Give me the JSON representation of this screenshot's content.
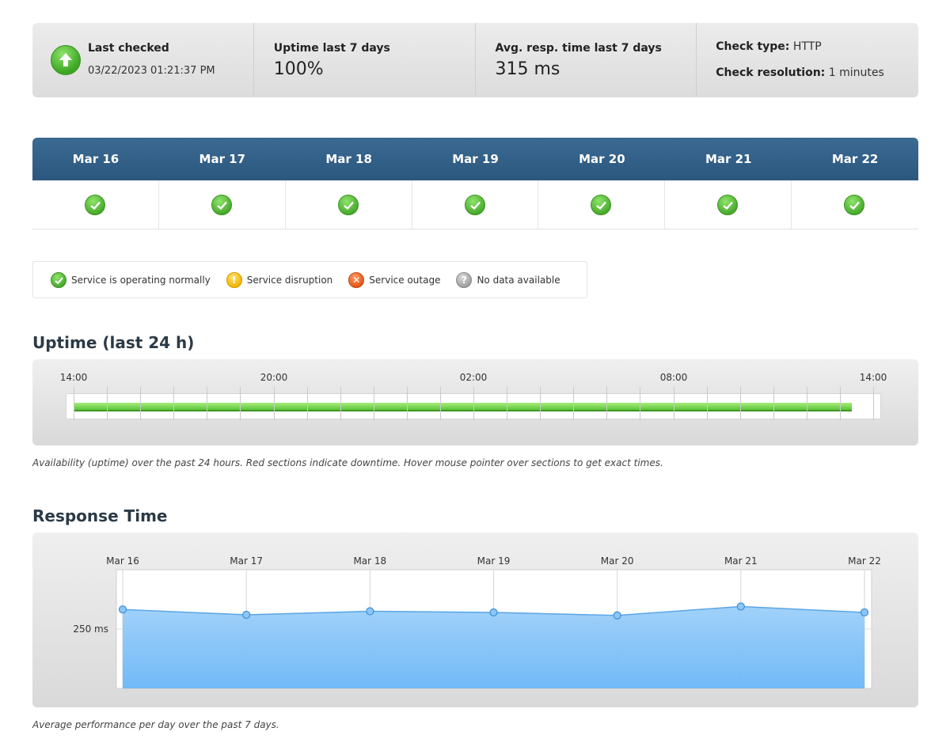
{
  "summary": {
    "last_checked_label": "Last checked",
    "last_checked_value": "03/22/2023 01:21:37 PM",
    "uptime_label": "Uptime last 7 days",
    "uptime_value": "100%",
    "resp_label": "Avg. resp. time last 7 days",
    "resp_value": "315 ms",
    "check_type_label": "Check type:",
    "check_type_value": "HTTP",
    "check_resolution_label": "Check resolution:",
    "check_resolution_value": "1 minutes",
    "status_icon": "up-arrow-icon"
  },
  "week": {
    "days": [
      "Mar 16",
      "Mar 17",
      "Mar 18",
      "Mar 19",
      "Mar 20",
      "Mar 21",
      "Mar 22"
    ],
    "status": [
      "ok",
      "ok",
      "ok",
      "ok",
      "ok",
      "ok",
      "ok"
    ]
  },
  "legend": [
    {
      "icon": "ok",
      "label": "Service is operating normally"
    },
    {
      "icon": "warn",
      "label": "Service disruption"
    },
    {
      "icon": "bad",
      "label": "Service outage"
    },
    {
      "icon": "nodata",
      "label": "No data available"
    }
  ],
  "uptime": {
    "title": "Uptime (last 24 h)",
    "tick_labels": [
      "14:00",
      "20:00",
      "02:00",
      "08:00",
      "14:00"
    ],
    "caption": "Availability (uptime) over the past 24 hours. Red sections indicate downtime. Hover mouse pointer over sections to get exact times.",
    "uptime_fraction": 1.0
  },
  "response": {
    "title": "Response Time",
    "caption": "Average performance per day over the past 7 days."
  },
  "colors": {
    "header_blue": "#2f5d85",
    "uptime_green": "#5dc43a",
    "area_blue": "#7fc0f8"
  },
  "chart_data": {
    "type": "area",
    "categories": [
      "Mar 16",
      "Mar 17",
      "Mar 18",
      "Mar 19",
      "Mar 20",
      "Mar 21",
      "Mar 22"
    ],
    "values": [
      283,
      274,
      280,
      278,
      273,
      288,
      278
    ],
    "ylabel": "",
    "ytick_labels": [
      "250 ms"
    ],
    "ytick_values": [
      250
    ],
    "ylim": [
      150,
      350
    ],
    "grid": true,
    "legend": "none"
  }
}
